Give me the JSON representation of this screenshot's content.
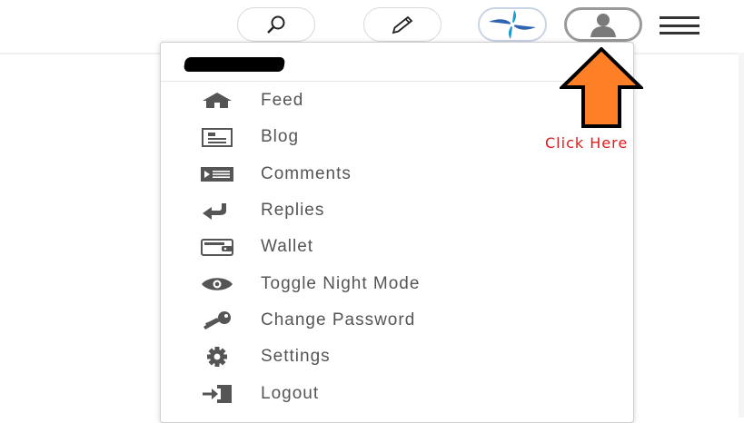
{
  "header": {
    "search_icon": "search-icon",
    "edit_icon": "pencil-icon",
    "brand_icon": "pinwheel-logo",
    "profile_icon": "user-avatar-icon",
    "menu_icon": "hamburger-icon"
  },
  "dropdown": {
    "username": "",
    "items": [
      {
        "label": "Feed",
        "icon": "home-icon"
      },
      {
        "label": "Blog",
        "icon": "blog-icon"
      },
      {
        "label": "Comments",
        "icon": "comments-icon"
      },
      {
        "label": "Replies",
        "icon": "reply-icon"
      },
      {
        "label": "Wallet",
        "icon": "wallet-icon"
      },
      {
        "label": "Toggle Night Mode",
        "icon": "eye-icon"
      },
      {
        "label": "Change Password",
        "icon": "key-icon"
      },
      {
        "label": "Settings",
        "icon": "gear-icon"
      },
      {
        "label": "Logout",
        "icon": "logout-icon"
      }
    ]
  },
  "annotation": {
    "text": "Click Here",
    "text_color": "#e01b1b",
    "arrow_fill": "#ff7f27"
  }
}
